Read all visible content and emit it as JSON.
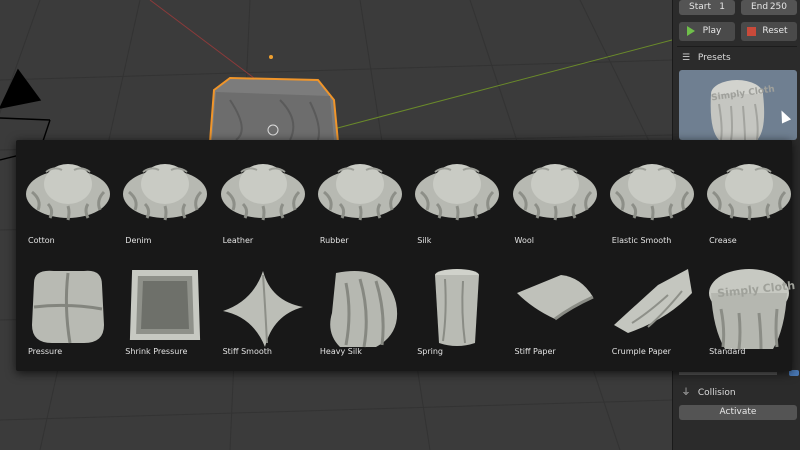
{
  "timeline": {
    "start_label": "Start",
    "start_value": "1",
    "end_label": "End",
    "end_value": "250",
    "play_label": "Play",
    "reset_label": "Reset"
  },
  "presets_panel": {
    "title": "Presets",
    "preview_text": "Simply Cloth"
  },
  "collision_panel": {
    "title": "Collision",
    "activate_label": "Activate"
  },
  "preset_grid": {
    "items": [
      {
        "label": "Cotton",
        "icon": "draped-cloth"
      },
      {
        "label": "Denim",
        "icon": "draped-cloth"
      },
      {
        "label": "Leather",
        "icon": "draped-cloth"
      },
      {
        "label": "Rubber",
        "icon": "draped-cloth"
      },
      {
        "label": "Silk",
        "icon": "draped-cloth"
      },
      {
        "label": "Wool",
        "icon": "draped-cloth"
      },
      {
        "label": "Elastic Smooth",
        "icon": "draped-cloth"
      },
      {
        "label": "Crease",
        "icon": "draped-cloth"
      },
      {
        "label": "Pressure",
        "icon": "pillow"
      },
      {
        "label": "Shrink Pressure",
        "icon": "cloth-cube"
      },
      {
        "label": "Stiff Smooth",
        "icon": "stiff-sheet"
      },
      {
        "label": "Heavy Silk",
        "icon": "hanging-cloth"
      },
      {
        "label": "Spring",
        "icon": "cylinder"
      },
      {
        "label": "Stiff Paper",
        "icon": "curled-paper"
      },
      {
        "label": "Crumple Paper",
        "icon": "crumpled-paper"
      },
      {
        "label": "Standard",
        "icon": "tablecloth"
      }
    ],
    "standard_text": "Simply Cloth"
  },
  "colors": {
    "viewport_bg": "#3b3b3b",
    "popup_bg": "#181818",
    "panel_bg": "#2b2b2b",
    "field_bg": "#545454",
    "play_icon": "#6fbf4a",
    "reset_icon": "#c94a3a",
    "selection_outline": "#f0952a",
    "cloth": "#b9bbb4"
  }
}
